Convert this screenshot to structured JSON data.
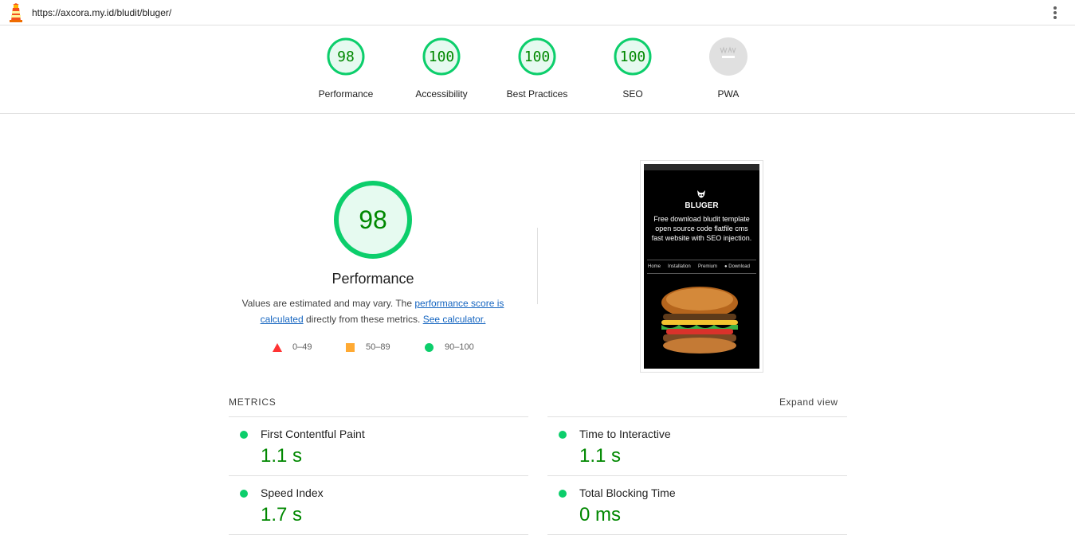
{
  "header": {
    "url": "https://axcora.my.id/bludit/bluger/"
  },
  "scores": [
    {
      "label": "Performance",
      "value": "98",
      "score": 98
    },
    {
      "label": "Accessibility",
      "value": "100",
      "score": 100
    },
    {
      "label": "Best Practices",
      "value": "100",
      "score": 100
    },
    {
      "label": "SEO",
      "value": "100",
      "score": 100
    },
    {
      "label": "PWA",
      "value": "",
      "score": null
    }
  ],
  "performance": {
    "score": "98",
    "title": "Performance",
    "desc_prefix": "Values are estimated and may vary. The ",
    "desc_link1": "performance score is calculated",
    "desc_middle": " directly from these metrics. ",
    "desc_link2": "See calculator."
  },
  "legend": [
    {
      "range": "0–49",
      "color": "#ff3333",
      "shape": "triangle"
    },
    {
      "range": "50–89",
      "color": "#ffaa33",
      "shape": "square"
    },
    {
      "range": "90–100",
      "color": "#0cce6b",
      "shape": "circle"
    }
  ],
  "screenshot": {
    "brand": "BLUGER",
    "tagline": "Free download bludit template open source code flatfile cms fast website with SEO injection.",
    "nav": [
      "Home",
      "Installation",
      "Premium",
      "Download"
    ]
  },
  "metrics": {
    "heading": "METRICS",
    "expand_label": "Expand view",
    "items": [
      {
        "name": "First Contentful Paint",
        "value": "1.1 s"
      },
      {
        "name": "Time to Interactive",
        "value": "1.1 s"
      },
      {
        "name": "Speed Index",
        "value": "1.7 s"
      },
      {
        "name": "Total Blocking Time",
        "value": "0 ms"
      }
    ]
  },
  "colors": {
    "pass": "#0cce6b",
    "pass_text": "#008800",
    "link": "#1565c0"
  },
  "icons": {
    "logo": "lighthouse-icon",
    "menu": "kebab-menu-icon",
    "pwa": "pwa-icon"
  }
}
